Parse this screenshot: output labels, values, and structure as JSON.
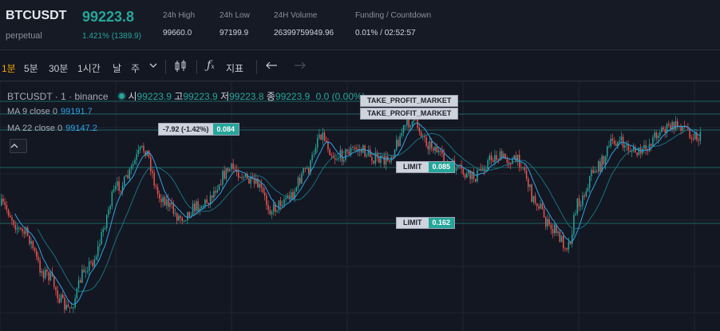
{
  "header": {
    "symbol": "BTCUSDT",
    "symbol_type": "perpetual",
    "last_price": "99223.8",
    "change": "1.421% (1389.9)",
    "stats": [
      {
        "label": "24h High",
        "value": "99660.0"
      },
      {
        "label": "24h Low",
        "value": "97199.9"
      },
      {
        "label": "24H Volume",
        "value": "26399759949.96"
      },
      {
        "label": "Funding / Countdown",
        "value": "0.01% / 02:52:57"
      }
    ]
  },
  "toolbar": {
    "intervals": [
      "1분",
      "5분",
      "30분",
      "1시간",
      "날",
      "주"
    ],
    "active_interval": "1분",
    "indicators_label": "지표"
  },
  "chart": {
    "legend": {
      "title": "BTCUSDT · 1 · binance",
      "o_label": "시",
      "o_value": "99223.9",
      "h_label": "고",
      "h_value": "99223.9",
      "l_label": "저",
      "l_value": "99223.8",
      "c_label": "종",
      "c_value": "99223.9",
      "change_value": "0.0 (0.00%)"
    },
    "ma9": {
      "label": "MA 9 close 0",
      "value": "99191.7"
    },
    "ma22": {
      "label": "MA 22 close 0",
      "value": "99147.2"
    },
    "orders": [
      {
        "label": "TAKE_PROFIT_MARKET"
      },
      {
        "label": "TAKE_PROFIT_MARKET"
      },
      {
        "label": "LIMIT",
        "amount": "0.085"
      },
      {
        "label": "LIMIT",
        "amount": "0.162"
      }
    ],
    "position_pl": {
      "label": "-7.92 (-1.42%)",
      "amount": "0.084"
    },
    "colors": {
      "up": "#26a69a",
      "down": "#ef5350",
      "ma9": "#2ea3e6",
      "ma22": "#1a7a8a",
      "order_line": "#26a69a"
    }
  }
}
